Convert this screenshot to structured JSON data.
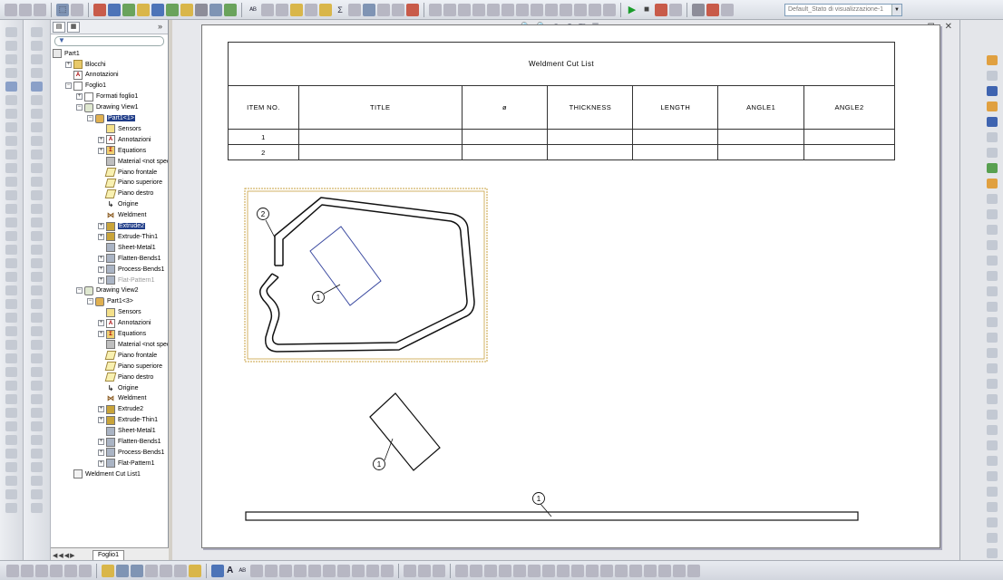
{
  "toolbar_top": {
    "configuration_value": "Default_Stato di visualizzazione-1",
    "icons": [
      "new-icon",
      "open-icon",
      "save-icon",
      "print-icon",
      "select-icon",
      "rebuild-icon",
      "options-icon",
      "spell-check-icon",
      "sum-icon",
      "run-macro-icon",
      "stop-macro-icon",
      "record-macro-icon",
      "camera-icon"
    ]
  },
  "feature_manager": {
    "root": "Part1",
    "sheet_tab": "Foglio1",
    "tree": [
      {
        "label": "Blocchi",
        "depth": 1,
        "icon": "folder",
        "exp": "+"
      },
      {
        "label": "Annotazioni",
        "depth": 1,
        "icon": "annot",
        "exp": ""
      },
      {
        "label": "Foglio1",
        "depth": 1,
        "icon": "sheet",
        "exp": "-"
      },
      {
        "label": "Formati foglio1",
        "depth": 2,
        "icon": "sheet",
        "exp": "+"
      },
      {
        "label": "Drawing View1",
        "depth": 2,
        "icon": "view",
        "exp": "-"
      },
      {
        "label": "Part1<1>",
        "depth": 3,
        "icon": "comp",
        "exp": "-",
        "selected": true
      },
      {
        "label": "Sensors",
        "depth": 4,
        "icon": "sensor",
        "exp": ""
      },
      {
        "label": "Annotazioni",
        "depth": 4,
        "icon": "annot",
        "exp": "+"
      },
      {
        "label": "Equations",
        "depth": 4,
        "icon": "eq",
        "exp": "+"
      },
      {
        "label": "Material <not specif",
        "depth": 4,
        "icon": "mat",
        "exp": ""
      },
      {
        "label": "Piano frontale",
        "depth": 4,
        "icon": "plane",
        "exp": ""
      },
      {
        "label": "Piano superiore",
        "depth": 4,
        "icon": "plane",
        "exp": ""
      },
      {
        "label": "Piano destro",
        "depth": 4,
        "icon": "plane",
        "exp": ""
      },
      {
        "label": "Origine",
        "depth": 4,
        "icon": "origin",
        "exp": ""
      },
      {
        "label": "Weldment",
        "depth": 4,
        "icon": "weld",
        "exp": ""
      },
      {
        "label": "Extrude2",
        "depth": 4,
        "icon": "feat",
        "exp": "+",
        "selected": true
      },
      {
        "label": "Extrude-Thin1",
        "depth": 4,
        "icon": "feat",
        "exp": "+"
      },
      {
        "label": "Sheet-Metal1",
        "depth": 4,
        "icon": "sm",
        "exp": ""
      },
      {
        "label": "Flatten-Bends1",
        "depth": 4,
        "icon": "sm",
        "exp": "+"
      },
      {
        "label": "Process-Bends1",
        "depth": 4,
        "icon": "sm",
        "exp": "+"
      },
      {
        "label": "Flat-Pattern1",
        "depth": 4,
        "icon": "sm",
        "exp": "+",
        "greyed": true
      },
      {
        "label": "Drawing View2",
        "depth": 2,
        "icon": "view",
        "exp": "-"
      },
      {
        "label": "Part1<3>",
        "depth": 3,
        "icon": "comp",
        "exp": "-"
      },
      {
        "label": "Sensors",
        "depth": 4,
        "icon": "sensor",
        "exp": ""
      },
      {
        "label": "Annotazioni",
        "depth": 4,
        "icon": "annot",
        "exp": "+"
      },
      {
        "label": "Equations",
        "depth": 4,
        "icon": "eq",
        "exp": "+"
      },
      {
        "label": "Material <not specif",
        "depth": 4,
        "icon": "mat",
        "exp": ""
      },
      {
        "label": "Piano frontale",
        "depth": 4,
        "icon": "plane",
        "exp": ""
      },
      {
        "label": "Piano superiore",
        "depth": 4,
        "icon": "plane",
        "exp": ""
      },
      {
        "label": "Piano destro",
        "depth": 4,
        "icon": "plane",
        "exp": ""
      },
      {
        "label": "Origine",
        "depth": 4,
        "icon": "origin",
        "exp": ""
      },
      {
        "label": "Weldment",
        "depth": 4,
        "icon": "weld",
        "exp": ""
      },
      {
        "label": "Extrude2",
        "depth": 4,
        "icon": "feat",
        "exp": "+"
      },
      {
        "label": "Extrude-Thin1",
        "depth": 4,
        "icon": "feat",
        "exp": "+"
      },
      {
        "label": "Sheet-Metal1",
        "depth": 4,
        "icon": "sm",
        "exp": ""
      },
      {
        "label": "Flatten-Bends1",
        "depth": 4,
        "icon": "sm",
        "exp": "+"
      },
      {
        "label": "Process-Bends1",
        "depth": 4,
        "icon": "sm",
        "exp": "+"
      },
      {
        "label": "Flat-Pattern1",
        "depth": 4,
        "icon": "sm",
        "exp": "+"
      },
      {
        "label": "Weldment Cut List1",
        "depth": 1,
        "icon": "cut",
        "exp": ""
      }
    ]
  },
  "drawing": {
    "table_title": "Weldment Cut List",
    "headers": [
      "ITEM NO.",
      "TITLE",
      "ø",
      "THICKNESS",
      "LENGTH",
      "ANGLE1",
      "ANGLE2"
    ],
    "rows": [
      [
        "1",
        "",
        "",
        "",
        "",
        "",
        ""
      ],
      [
        "2",
        "",
        "",
        "",
        "",
        "",
        ""
      ]
    ],
    "balloons": {
      "b1": "1",
      "b2": "2",
      "b3": "1",
      "b4": "1"
    }
  },
  "colors": {
    "selection": "#1f3c88",
    "view_border": "#c8a040",
    "sheet": "#ffffff"
  }
}
